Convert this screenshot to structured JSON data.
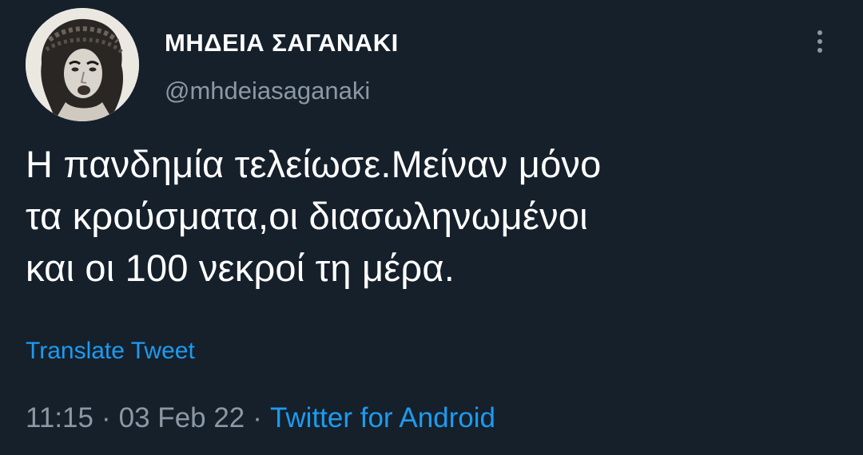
{
  "user": {
    "display_name": "ΜΗΔΕΙΑ ΣΑΓΑΝΑΚΙ",
    "handle": "@mhdeiasaganaki",
    "avatar_icon": "user-photo"
  },
  "tweet": {
    "lines": [
      "Η πανδημία τελείωσε.Μείναν μόνο",
      "τα κρούσματα,οι διασωληνωμένοι",
      "και οι 100 νεκροί τη μέρα."
    ],
    "translate_label": "Translate Tweet",
    "time": "11:15",
    "separator": "·",
    "date": "03 Feb 22",
    "source": "Twitter for Android"
  },
  "icons": {
    "more": "more-vertical-icon"
  },
  "colors": {
    "background": "#15202b",
    "text": "#ffffff",
    "secondary_text": "#8b98a5",
    "link": "#1d9bf0"
  }
}
